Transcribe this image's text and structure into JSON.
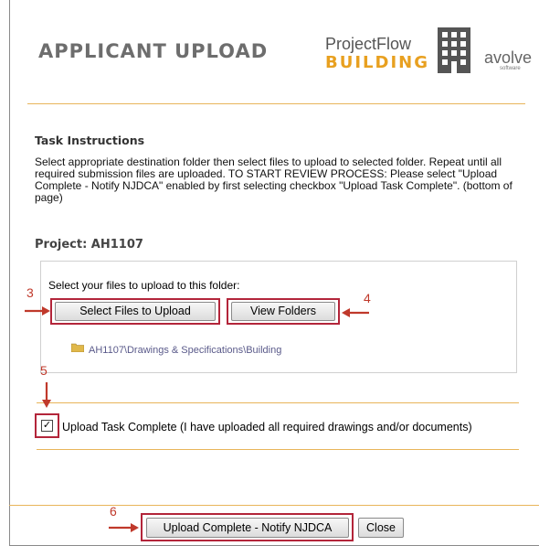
{
  "header": {
    "title": "APPLICANT UPLOAD",
    "logo_projectflow": "ProjectFlow",
    "logo_building": "BUILDING",
    "logo_avolve": "avolve",
    "logo_avolve_sub": "software"
  },
  "instructions": {
    "heading": "Task Instructions",
    "body": "Select appropriate destination folder then select files to upload to selected folder. Repeat until all required submission files are uploaded. TO START REVIEW PROCESS: Please select \"Upload Complete - Notify NJDCA\" enabled by first selecting checkbox \"Upload Task Complete\". (bottom of page)"
  },
  "project": {
    "title": "Project: AH1107"
  },
  "upload": {
    "prompt": "Select your files to upload to this folder:",
    "select_files_label": "Select Files to Upload",
    "view_folders_label": "View Folders",
    "folder_path": "AH1107\\Drawings & Specifications\\Building"
  },
  "task_complete": {
    "checked": true,
    "check_mark": "✓",
    "label": "Upload Task Complete (I have uploaded all required drawings and/or documents)"
  },
  "footer": {
    "notify_label": "Upload Complete - Notify NJDCA",
    "close_label": "Close"
  },
  "callouts": {
    "step3": "3",
    "step4": "4",
    "step5": "5",
    "step6": "6"
  },
  "colors": {
    "accent_rule": "#e8b55a",
    "highlight": "#b3253a",
    "building_orange": "#e8a020"
  }
}
